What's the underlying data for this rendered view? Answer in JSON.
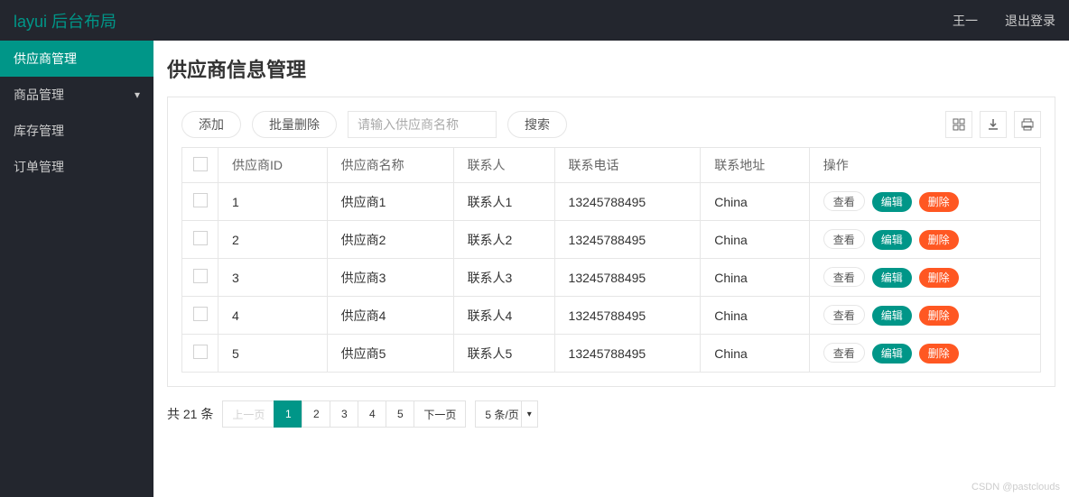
{
  "header": {
    "logo": "layui 后台布局",
    "username": "王一",
    "logout": "退出登录"
  },
  "sidebar": {
    "items": [
      {
        "label": "供应商管理",
        "active": true,
        "expandable": false
      },
      {
        "label": "商品管理",
        "active": false,
        "expandable": true
      },
      {
        "label": "库存管理",
        "active": false,
        "expandable": false
      },
      {
        "label": "订单管理",
        "active": false,
        "expandable": false
      }
    ]
  },
  "page": {
    "title": "供应商信息管理"
  },
  "toolbar": {
    "add": "添加",
    "batch_delete": "批量删除",
    "search_placeholder": "请输入供应商名称",
    "search": "搜索"
  },
  "table": {
    "headers": {
      "id": "供应商ID",
      "name": "供应商名称",
      "contact": "联系人",
      "phone": "联系电话",
      "address": "联系地址",
      "action": "操作"
    },
    "rows": [
      {
        "id": "1",
        "name": "供应商1",
        "contact": "联系人1",
        "phone": "13245788495",
        "address": "China"
      },
      {
        "id": "2",
        "name": "供应商2",
        "contact": "联系人2",
        "phone": "13245788495",
        "address": "China"
      },
      {
        "id": "3",
        "name": "供应商3",
        "contact": "联系人3",
        "phone": "13245788495",
        "address": "China"
      },
      {
        "id": "4",
        "name": "供应商4",
        "contact": "联系人4",
        "phone": "13245788495",
        "address": "China"
      },
      {
        "id": "5",
        "name": "供应商5",
        "contact": "联系人5",
        "phone": "13245788495",
        "address": "China"
      }
    ],
    "actions": {
      "view": "查看",
      "edit": "编辑",
      "delete": "删除"
    }
  },
  "pagination": {
    "total_text": "共 21 条",
    "prev": "上一页",
    "next": "下一页",
    "pages": [
      "1",
      "2",
      "3",
      "4",
      "5"
    ],
    "current": 1,
    "per_page": "5 条/页"
  },
  "watermark": "CSDN @pastclouds"
}
